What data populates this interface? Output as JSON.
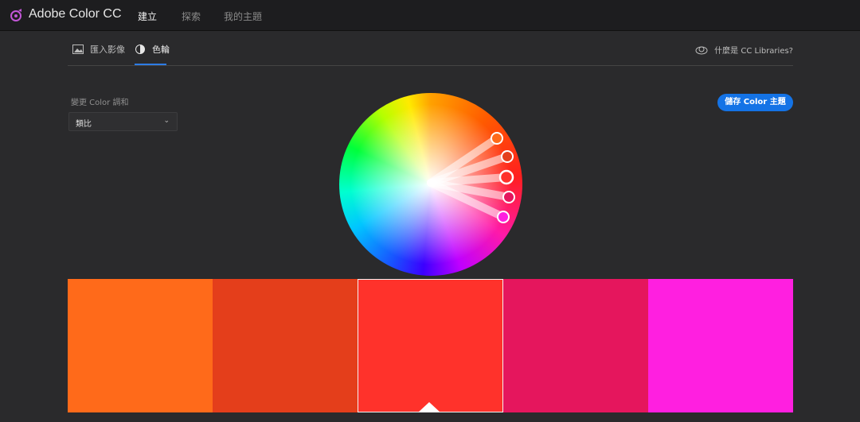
{
  "app": {
    "title": "Adobe Color CC"
  },
  "nav": {
    "tabs": [
      {
        "label": "建立",
        "active": true
      },
      {
        "label": "探索",
        "active": false
      },
      {
        "label": "我的主題",
        "active": false
      }
    ]
  },
  "subtabs": [
    {
      "label": "匯入影像",
      "icon": "image-icon",
      "active": false
    },
    {
      "label": "色輪",
      "icon": "color-wheel-icon",
      "active": true
    }
  ],
  "cc_help": {
    "label": "什麼是 CC Libraries?"
  },
  "harmony": {
    "label": "變更 Color 調和",
    "value": "類比"
  },
  "save_button": {
    "label": "儲存 Color 主題",
    "color": "#1473e6"
  },
  "swatches": [
    {
      "color": "#ff6a1a"
    },
    {
      "color": "#e43e1b"
    },
    {
      "color": "#ff322b",
      "selected": true
    },
    {
      "color": "#e5165d"
    },
    {
      "color": "#ff1fe0"
    }
  ]
}
